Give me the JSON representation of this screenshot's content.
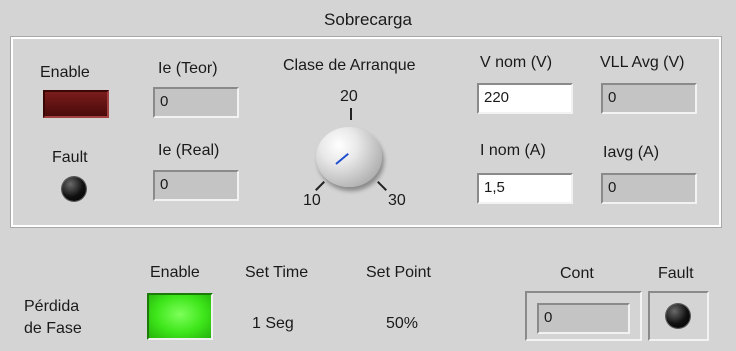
{
  "title": "Sobrecarga",
  "overload": {
    "enable_label": "Enable",
    "fault_label": "Fault",
    "ie_teor": {
      "label": "Ie (Teor)",
      "value": "0"
    },
    "ie_real": {
      "label": "Ie (Real)",
      "value": "0"
    },
    "clase": {
      "label": "Clase de Arranque",
      "tick_min": "10",
      "tick_mid": "20",
      "tick_max": "30"
    },
    "v_nom": {
      "label": "V nom (V)",
      "value": "220"
    },
    "i_nom": {
      "label": "I nom (A)",
      "value": "1,5"
    },
    "vll_avg": {
      "label": "VLL Avg (V)",
      "value": "0"
    },
    "i_avg": {
      "label": "Iavg (A)",
      "value": "0"
    }
  },
  "phase_loss": {
    "label_line1": "Pérdida",
    "label_line2": "de Fase",
    "enable_label": "Enable",
    "set_time_label": "Set Time",
    "set_time_value": "1 Seg",
    "set_point_label": "Set Point",
    "set_point_value": "50%",
    "cont_label": "Cont",
    "cont_value": "0",
    "fault_label": "Fault"
  }
}
